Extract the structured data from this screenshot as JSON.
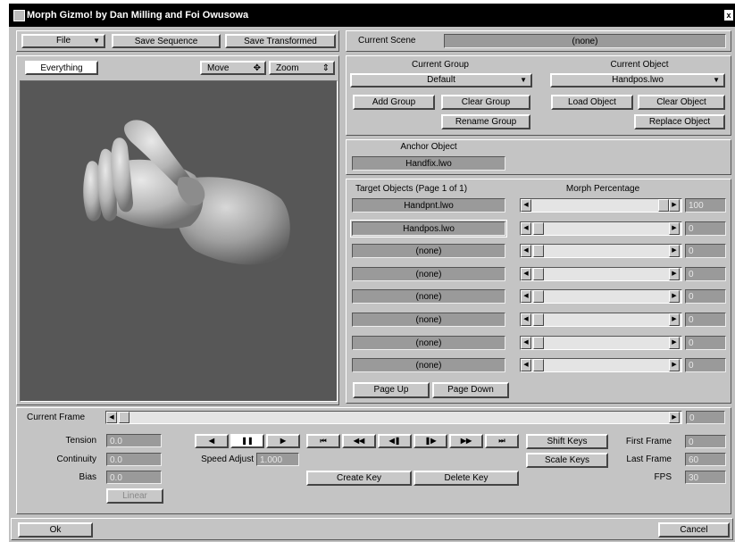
{
  "window": {
    "title": "Morph Gizmo! by Dan Milling and Foi Owusowa",
    "close_glyph": "x"
  },
  "toolbar": {
    "file_menu": "File",
    "save_sequence": "Save Sequence",
    "save_transformed": "Save Transformed"
  },
  "scene": {
    "label": "Current Scene",
    "value": "(none)"
  },
  "viewport": {
    "everything_button": "Everything",
    "move_label": "Move",
    "zoom_label": "Zoom",
    "move_glyph": "✥",
    "zoom_glyph": "⇕"
  },
  "group": {
    "label": "Current Group",
    "value": "Default",
    "add": "Add Group",
    "clear": "Clear Group",
    "rename": "Rename Group"
  },
  "object": {
    "label": "Current Object",
    "value": "Handpos.lwo",
    "load": "Load Object",
    "clear": "Clear Object",
    "replace": "Replace Object"
  },
  "anchor": {
    "label": "Anchor Object",
    "value": "Handfix.lwo"
  },
  "targets": {
    "header_left": "Target Objects  (Page 1 of 1)",
    "header_right": "Morph Percentage",
    "rows": [
      {
        "name": "Handpnt.lwo",
        "percent": 100,
        "value_text": "100"
      },
      {
        "name": "Handpos.lwo",
        "percent": 0,
        "value_text": "0"
      },
      {
        "name": "(none)",
        "percent": 0,
        "value_text": "0"
      },
      {
        "name": "(none)",
        "percent": 0,
        "value_text": "0"
      },
      {
        "name": "(none)",
        "percent": 0,
        "value_text": "0"
      },
      {
        "name": "(none)",
        "percent": 0,
        "value_text": "0"
      },
      {
        "name": "(none)",
        "percent": 0,
        "value_text": "0"
      },
      {
        "name": "(none)",
        "percent": 0,
        "value_text": "0"
      }
    ],
    "page_up": "Page Up",
    "page_down": "Page Down"
  },
  "timeline": {
    "label": "Current Frame",
    "value": "0"
  },
  "spline": {
    "tension_label": "Tension",
    "tension_value": "0.0",
    "continuity_label": "Continuity",
    "continuity_value": "0.0",
    "bias_label": "Bias",
    "bias_value": "0.0",
    "linear_button": "Linear"
  },
  "playback": {
    "rewind": "◀",
    "pause": "❚❚",
    "play": "▶",
    "first": "⏮",
    "prev": "◀◀",
    "step_back": "◀❚",
    "step_fwd": "❚▶",
    "next": "▶▶",
    "last": "⏭",
    "speed_label": "Speed Adjust",
    "speed_value": "1.000"
  },
  "keys": {
    "create": "Create Key",
    "delete": "Delete Key",
    "shift": "Shift Keys",
    "scale": "Scale Keys"
  },
  "frames": {
    "first_label": "First Frame",
    "first_value": "0",
    "last_label": "Last Frame",
    "last_value": "60",
    "fps_label": "FPS",
    "fps_value": "30"
  },
  "footer": {
    "ok": "Ok",
    "cancel": "Cancel"
  },
  "colors": {
    "viewport_bg": "#575757",
    "panel": "#c0c0c0",
    "field": "#9a9a9a",
    "title_bg": "#000000"
  }
}
